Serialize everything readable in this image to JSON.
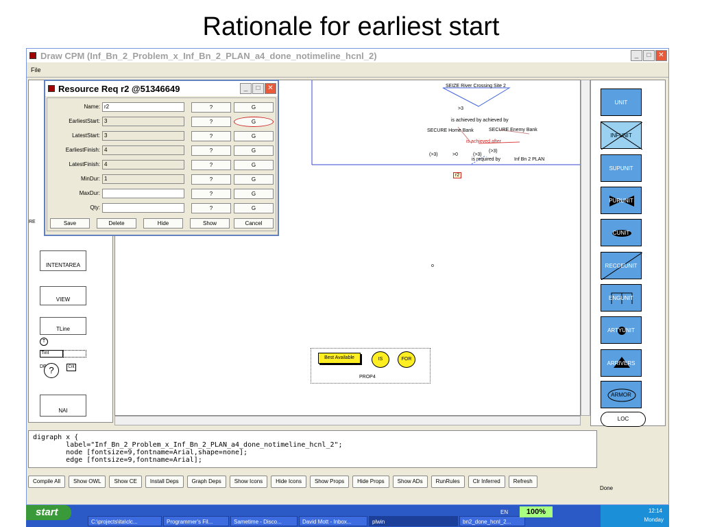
{
  "slide_title": "Rationale for earliest start",
  "window": {
    "title": "Draw CPM (Inf_Bn_2_Problem_x_Inf_Bn_2_PLAN_a4_done_notimeline_hcnl_2)",
    "menu_file": "File"
  },
  "dialog": {
    "title": "Resource Req r2 @51346649",
    "fields": [
      {
        "label": "Name:",
        "value": "r2",
        "q": "?",
        "g": "G"
      },
      {
        "label": "EarliestStart:",
        "value": "3",
        "q": "?",
        "g": "G"
      },
      {
        "label": "LatestStart:",
        "value": "3",
        "q": "?",
        "g": "G"
      },
      {
        "label": "EarliestFinish:",
        "value": "4",
        "q": "?",
        "g": "G"
      },
      {
        "label": "LatestFinish:",
        "value": "4",
        "q": "?",
        "g": "G"
      },
      {
        "label": "MinDur:",
        "value": "1",
        "q": "?",
        "g": "G"
      },
      {
        "label": "MaxDur:",
        "value": "",
        "q": "?",
        "g": "G"
      },
      {
        "label": "Qty:",
        "value": "",
        "q": "?",
        "g": "G"
      }
    ],
    "buttons": {
      "save": "Save",
      "delete": "Delete",
      "hide": "Hide",
      "show": "Show",
      "cancel": "Cancel"
    }
  },
  "left_palette": {
    "intentarea": "INTENTAREA",
    "view": "VIEW",
    "tline": "TLine",
    "t_icon": "T",
    "tint": "Tint",
    "dp": "DP",
    "crit": "Crit",
    "question": "?",
    "nai": "NAI",
    "re": "RE"
  },
  "canvas": {
    "seize": "SEIZE River Crossing Site 2",
    "gt3": ">3",
    "achieved_by": "is achieved by achieved by",
    "secure_home": "SECURE Home Bank",
    "secure_enemy": "SECURE Enemy Bank",
    "achieved_after": "is achieved after",
    "p3a": "(>3)",
    "p0": ">0",
    "p3b": "(>3)",
    "p3c": "(>3)",
    "required_by": "is required by",
    "inf_plan": "Inf Bn 2 PLAN",
    "r2": "r2",
    "o": "o",
    "best_available": "Best Available",
    "is": "IS",
    "for": "FOR",
    "prop4": "PROP4"
  },
  "right_palette": [
    "UNIT",
    "INFUNIT",
    "SUPUNIT",
    "PURUNIT",
    "CUNIT",
    "RECCEUNIT",
    "ENGUNIT",
    "ARTYUNIT",
    "ARRIVERS",
    "ARMOR",
    "LOC"
  ],
  "code_lines": [
    "digraph x {",
    "        label=\"Inf_Bn_2_Problem_x_Inf_Bn_2_PLAN_a4_done_notimeline_hcnl_2\";",
    "        node [fontsize=9,fontname=Arial,shape=none];",
    "        edge [fontsize=9,fontname=Arial];"
  ],
  "toolbar": [
    "Compile All",
    "Show OWL",
    "Show CE",
    "Install Deps",
    "Graph Deps",
    "Show Icons",
    "Hide Icons",
    "Show Props",
    "Hide Props",
    "Show ADs",
    "RunRules",
    "Clr Inferred",
    "Refresh"
  ],
  "status": "Done",
  "taskbar": {
    "start": "start",
    "lang": "EN",
    "zoom": "100%",
    "time": "12:14",
    "day": "Monday",
    "tasks": [
      "C:\\projects\\ita\\clc...",
      "Programmer's Fil...",
      "Sametime - Disco...",
      "David Mott - Inbox...",
      "plwin",
      "bn2_done_hcnl_2..."
    ]
  }
}
